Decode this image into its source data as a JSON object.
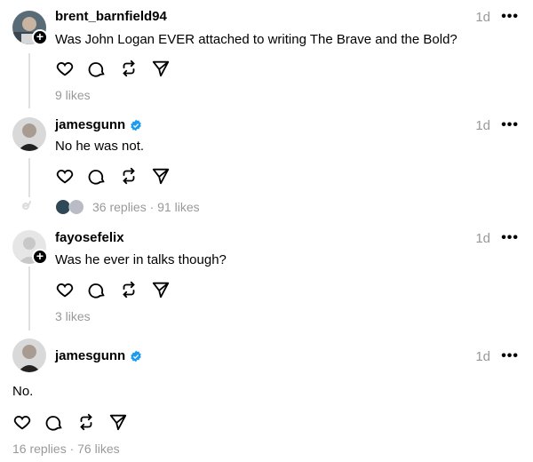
{
  "posts": [
    {
      "username": "brent_barnfield94",
      "time": "1d",
      "text": "Was John Logan EVER attached to writing The Brave and the Bold?",
      "meta": "9 likes"
    },
    {
      "username": "jamesgunn",
      "time": "1d",
      "text": "No he was not.",
      "meta": "36 replies · 91 likes"
    },
    {
      "username": "fayosefelix",
      "time": "1d",
      "text": "Was he ever in talks though?",
      "meta": "3 likes"
    },
    {
      "username": "jamesgunn",
      "time": "1d",
      "text": "No.",
      "meta": "16 replies · 76 likes"
    }
  ],
  "more_label": "•••",
  "icons": [
    "heart-icon",
    "comment-icon",
    "repost-icon",
    "share-icon",
    "verified-icon",
    "plus-icon"
  ],
  "colors": {
    "verified": "#1d9bf0",
    "meta": "#999999",
    "thread_line": "#e0e0e0"
  }
}
